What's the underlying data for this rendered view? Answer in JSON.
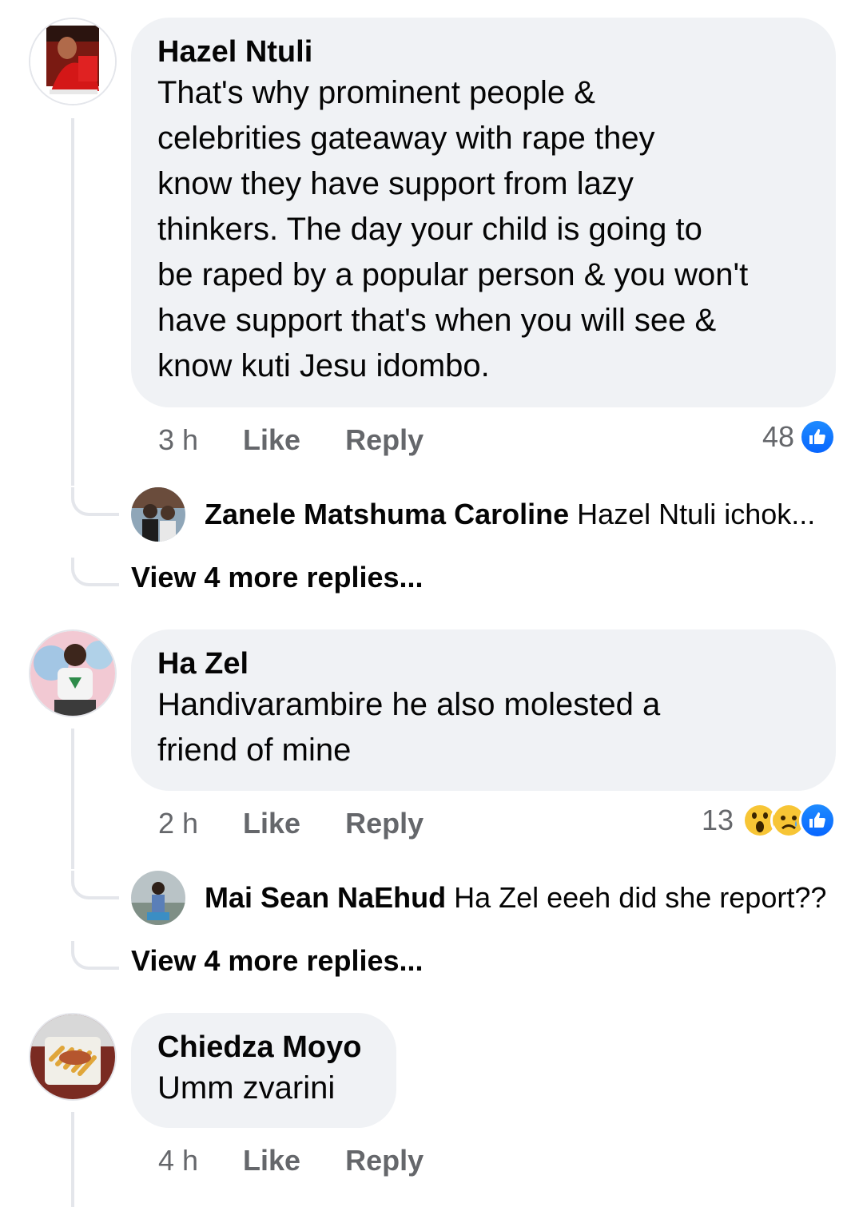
{
  "comments": [
    {
      "author": "Hazel Ntuli",
      "text_lines": [
        "That's why prominent people &",
        "celebrities gateaway with rape they",
        "know they have support from lazy",
        "thinkers. The day your child is going to",
        "be raped by a popular person & you won't",
        "have support that's when you will see &",
        "know kuti Jesu idombo."
      ],
      "time": "3 h",
      "like_label": "Like",
      "reply_label": "Reply",
      "reaction_count": "48",
      "reaction_icons": [
        "like-icon"
      ],
      "reply_preview": {
        "author": "Zanele Matshuma Caroline",
        "text": "Hazel Ntuli ichok..."
      },
      "more_replies": "View 4 more replies..."
    },
    {
      "author": "Ha Zel",
      "text_lines": [
        "Handivarambire he also molested a",
        "friend of mine"
      ],
      "time": "2 h",
      "like_label": "Like",
      "reply_label": "Reply",
      "reaction_count": "13",
      "reaction_icons": [
        "wow-icon",
        "sad-icon",
        "like-icon"
      ],
      "reply_preview": {
        "author": "Mai Sean NaEhud",
        "text": "Ha Zel eeeh did she report??"
      },
      "more_replies": "View 4 more replies..."
    },
    {
      "author": "Chiedza Moyo",
      "text_lines": [
        "Umm zvarini"
      ],
      "time": "4 h",
      "like_label": "Like",
      "reply_label": "Reply"
    }
  ],
  "colors": {
    "bubble": "#f0f2f5",
    "meta": "#65676b",
    "like": "#0866ff",
    "thread_line": "#e4e6eb"
  }
}
